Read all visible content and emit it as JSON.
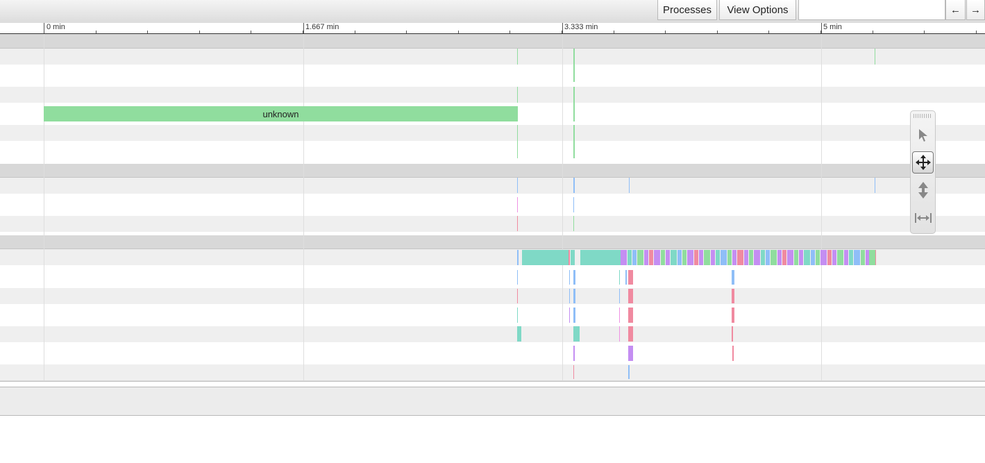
{
  "toolbar": {
    "processes_label": "Processes",
    "view_options_label": "View Options",
    "filter_value": "",
    "nav_prev_label": "←",
    "nav_next_label": "→"
  },
  "ruler": {
    "labels": [
      "0 min",
      "1.667 min",
      "3.333 min",
      "5 min"
    ]
  },
  "slice": {
    "label": "unknown",
    "color": "#90dd9e"
  },
  "tool_palette": {
    "tools": [
      {
        "name": "selection-tool",
        "icon": "cursor-arrow-icon",
        "active": false
      },
      {
        "name": "pan-tool",
        "icon": "move-arrows-icon",
        "active": true
      },
      {
        "name": "zoom-tool",
        "icon": "vertical-arrows-icon",
        "active": false
      },
      {
        "name": "timing-tool",
        "icon": "horizontal-range-icon",
        "active": false
      }
    ]
  },
  "colors": {
    "green": "#90dd9e",
    "teal": "#7fd9c6",
    "purple": "#c48ef2",
    "blue": "#8fbef7",
    "pink": "#f08aa0",
    "magenta": "#ef92e4",
    "row_alt": "#efefef",
    "header_row": "#d8d8d8"
  }
}
